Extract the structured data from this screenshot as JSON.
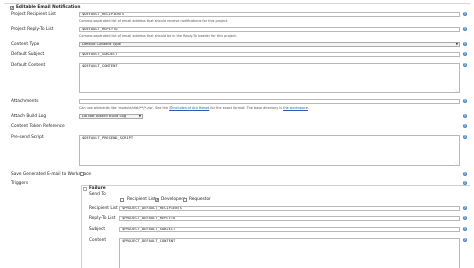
{
  "section": {
    "title": "Editable Email Notification",
    "checked": true
  },
  "fields": {
    "recipients": {
      "label": "Project Recipient List",
      "value": "$DEFAULT_RECIPIENTS",
      "hint": "Comma-separated list of email address that should receive notifications for this project."
    },
    "reply_to": {
      "label": "Project Reply-To List",
      "value": "$DEFAULT_REPLYTO",
      "hint": "Comma-separated list of email address that should be in the Reply-To header for this project."
    },
    "content_type": {
      "label": "Content Type",
      "value": "Default Content Type"
    },
    "default_subject": {
      "label": "Default Subject",
      "value": "$DEFAULT_SUBJECT"
    },
    "default_content": {
      "label": "Default Content",
      "value": "$DEFAULT_CONTENT"
    },
    "attachments": {
      "label": "Attachments",
      "hint_prefix": "Can use wildcards like 'module/dist/**/*.zip'. See the ",
      "hint_link1": "@includes of Ant fileset",
      "hint_middle": " for the exact format. The base directory is ",
      "hint_link2": "the workspace",
      "hint_suffix": "."
    },
    "attach_build_log": {
      "label": "Attach Build Log",
      "value": "Do Not Attach Build Log"
    },
    "content_token_ref": {
      "label": "Content Token Reference"
    },
    "presend_script": {
      "label": "Pre-send Script",
      "value": "$DEFAULT_PRESEND_SCRIPT"
    },
    "save_to_workspace": {
      "label": "Save Generated E-mail to Workspace",
      "checked": false
    },
    "triggers": {
      "label": "Triggers"
    }
  },
  "trigger": {
    "name": "Failure",
    "send_to": {
      "label": "Send To",
      "options": [
        {
          "label": "Recipient List",
          "checked": false
        },
        {
          "label": "Developers",
          "checked": true
        },
        {
          "label": "Requestor",
          "checked": false
        }
      ]
    },
    "recipient_list": {
      "label": "Recipient List",
      "value": "$PROJECT_DEFAULT_RECIPIENTS"
    },
    "reply_to": {
      "label": "Reply-To List",
      "value": "$PROJECT_DEFAULT_REPLYTO"
    },
    "subject": {
      "label": "Subject",
      "value": "$PROJECT_DEFAULT_SUBJECT"
    },
    "content": {
      "label": "Content",
      "value": "$PROJECT_DEFAULT_CONTENT"
    }
  },
  "icons": {
    "help": "help-icon",
    "dropdown": "chevron-down-icon",
    "resize": "resize-grip-icon"
  },
  "colors": {
    "help": "#4d84c8",
    "link": "#2a5db0"
  }
}
